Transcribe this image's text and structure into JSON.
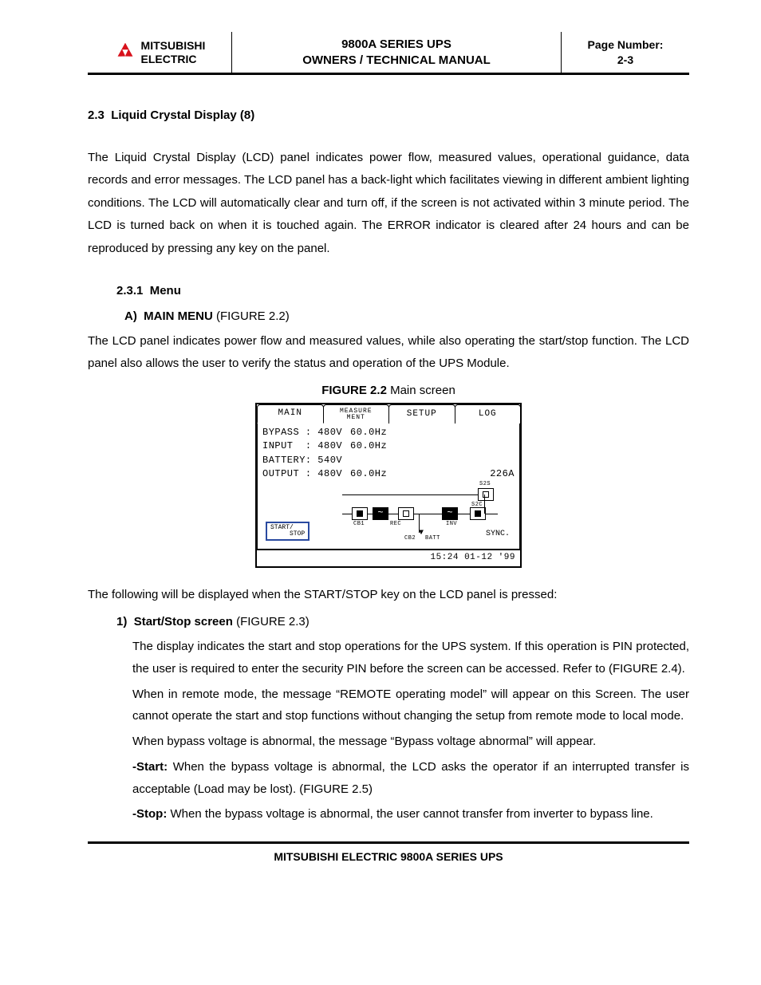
{
  "header": {
    "brand_top": "MITSUBISHI",
    "brand_bot": "ELECTRIC",
    "title_l1": "9800A SERIES UPS",
    "title_l2": "OWNERS / TECHNICAL MANUAL",
    "page_label": "Page Number:",
    "page_num": "2-3"
  },
  "section": {
    "num": "2.3",
    "title": "Liquid Crystal Display (8)",
    "para1": "The Liquid Crystal Display (LCD) panel indicates power flow, measured values, operational guidance, data records and error messages. The LCD panel has a back-light which facilitates viewing in different ambient lighting conditions. The LCD will automatically clear and turn off, if the screen is not activated within 3 minute period. The LCD is turned back on when it is touched again. The ERROR indicator is cleared after 24 hours and can be reproduced by pressing any key on the panel."
  },
  "menu": {
    "num": "2.3.1",
    "title": "Menu",
    "a_label": "A)",
    "a_title": "MAIN MENU",
    "a_ref": "(FIGURE 2.2)",
    "a_para": "The LCD panel indicates power flow and measured values, while also operating the start/stop function. The LCD panel also allows the user to verify the status and operation of the UPS Module."
  },
  "figure": {
    "label": "FIGURE 2.2",
    "caption": "Main screen"
  },
  "lcd": {
    "tabs": [
      "MAIN",
      "MEASURE\nMENT",
      "SETUP",
      "LOG"
    ],
    "rows": [
      {
        "l": "BYPASS : 480V",
        "m": "60.0Hz",
        "r": ""
      },
      {
        "l": "INPUT  : 480V",
        "m": "60.0Hz",
        "r": ""
      },
      {
        "l": "BATTERY: 540V",
        "m": "",
        "r": ""
      },
      {
        "l": "OUTPUT : 480V",
        "m": "60.0Hz",
        "r": "226A"
      }
    ],
    "labels": {
      "cb1": "CB1",
      "rec": "REC",
      "cb2": "CB2",
      "batt": "BATT",
      "inv": "INV",
      "s2s": "S2S",
      "s2c": "S2C"
    },
    "startstop": "START/\n      STOP",
    "sync": "SYNC.",
    "timestamp": "15:24 01-12 '99"
  },
  "after_fig": "The following will be displayed when the START/STOP key on the LCD panel is pressed:",
  "item1": {
    "label": "1)",
    "title": "Start/Stop screen",
    "ref": "(FIGURE 2.3)",
    "p1": "The display indicates the start and stop operations for the UPS system. If this operation is PIN protected, the user is required to enter the security PIN before the screen can be accessed. Refer to (FIGURE 2.4).",
    "p2": "When in remote mode, the message “REMOTE operating model” will appear on this Screen. The user cannot operate the start and stop functions without changing the setup from remote mode to local mode.",
    "p3": "When bypass voltage is abnormal, the message “Bypass voltage abnormal” will appear.",
    "start_label": "-Start:",
    "start_text": " When the bypass voltage is abnormal, the LCD asks the operator if an interrupted transfer is acceptable (Load may be lost). (FIGURE 2.5)",
    "stop_label": "-Stop:",
    "stop_text": " When the bypass voltage is abnormal, the user cannot transfer from inverter to bypass line."
  },
  "footer": "MITSUBISHI ELECTRIC 9800A SERIES UPS"
}
